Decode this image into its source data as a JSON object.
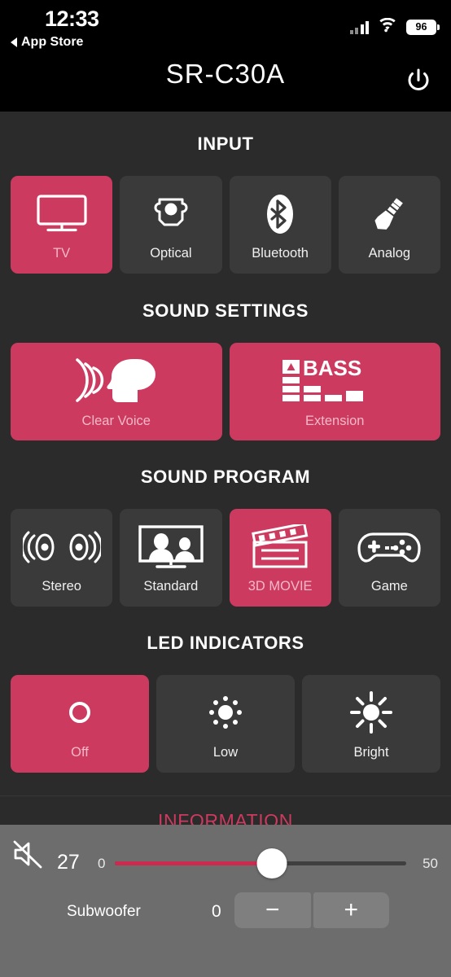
{
  "status_bar": {
    "time": "12:33",
    "back_label": "App Store",
    "battery_percent": "96"
  },
  "header": {
    "device_name": "SR-C30A",
    "power_icon": "power-icon"
  },
  "sections": [
    {
      "id": "input",
      "title": "INPUT",
      "tiles": [
        {
          "label": "TV",
          "icon": "tv-icon",
          "active": true
        },
        {
          "label": "Optical",
          "icon": "optical-icon",
          "active": false
        },
        {
          "label": "Bluetooth",
          "icon": "bluetooth-icon",
          "active": false
        },
        {
          "label": "Analog",
          "icon": "analog-jack-icon",
          "active": false
        }
      ]
    },
    {
      "id": "sound_settings",
      "title": "SOUND SETTINGS",
      "tiles": [
        {
          "label": "Clear Voice",
          "icon": "clear-voice-icon",
          "active": true
        },
        {
          "label": "Extension",
          "icon": "bass-extension-icon",
          "active": true
        }
      ]
    },
    {
      "id": "sound_program",
      "title": "SOUND PROGRAM",
      "tiles": [
        {
          "label": "Stereo",
          "icon": "stereo-speakers-icon",
          "active": false
        },
        {
          "label": "Standard",
          "icon": "standard-tv-icon",
          "active": false
        },
        {
          "label": "3D MOVIE",
          "icon": "clapperboard-icon",
          "active": true
        },
        {
          "label": "Game",
          "icon": "gamepad-icon",
          "active": false
        }
      ]
    },
    {
      "id": "led_indicators",
      "title": "LED INDICATORS",
      "tiles": [
        {
          "label": "Off",
          "icon": "circle-off-icon",
          "active": true
        },
        {
          "label": "Low",
          "icon": "brightness-low-icon",
          "active": false
        },
        {
          "label": "Bright",
          "icon": "brightness-high-icon",
          "active": false
        }
      ]
    }
  ],
  "information_link": "INFORMATION",
  "volume": {
    "mute_icon": "mute-speaker-icon",
    "value": "27",
    "min": "0",
    "max": "50",
    "percent": 54
  },
  "subwoofer": {
    "label": "Subwoofer",
    "value": "0",
    "minus_label": "−",
    "plus_label": "+"
  },
  "colors": {
    "accent": "#cd3a5f",
    "accent_track": "#cd2a50",
    "page_bg": "#2b2b2b",
    "tile_bg": "#3a3a3a",
    "bottom_bar_bg": "#6d6d6d"
  }
}
